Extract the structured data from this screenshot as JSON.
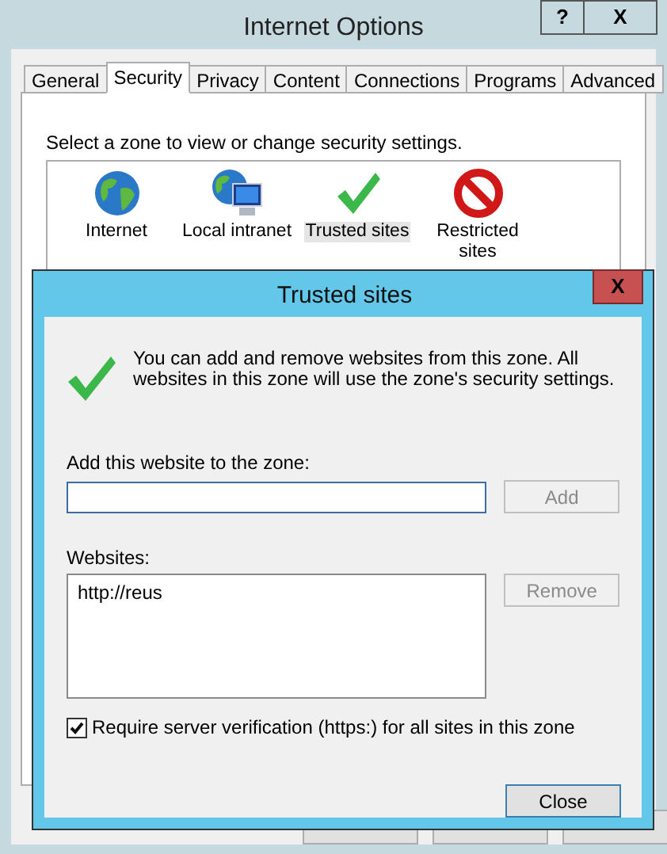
{
  "window": {
    "title": "Internet Options",
    "buttons": [
      "?",
      "X"
    ]
  },
  "tabs": [
    {
      "label": "General",
      "selected": false
    },
    {
      "label": "Security",
      "selected": true
    },
    {
      "label": "Privacy",
      "selected": false
    },
    {
      "label": "Content",
      "selected": false
    },
    {
      "label": "Connections",
      "selected": false
    },
    {
      "label": "Programs",
      "selected": false
    },
    {
      "label": "Advanced",
      "selected": false
    }
  ],
  "zone_prompt": "Select a zone to view or change security settings.",
  "zones": [
    {
      "kind": "globe",
      "label": "Internet",
      "selected": false
    },
    {
      "kind": "intranet",
      "label": "Local intranet",
      "selected": false
    },
    {
      "kind": "trusted",
      "label": "Trusted sites",
      "selected": true
    },
    {
      "kind": "restricted",
      "label": "Restricted sites",
      "selected": false
    }
  ],
  "dialog": {
    "title": "Trusted sites",
    "close": "X",
    "description": "You can add and remove websites from this zone. All websites in this zone will use the zone's security settings.",
    "add_label": "Add this website to the zone:",
    "add_button": {
      "label": "Add",
      "disabled": true
    },
    "websites_label": "Websites:",
    "websites": [
      "http://reus"
    ],
    "remove_button": {
      "label": "Remove",
      "disabled": true
    },
    "require_https": {
      "label": "Require server verification (https:) for all sites in this zone",
      "checked": true
    },
    "close_button": {
      "label": "Close",
      "disabled": false
    }
  }
}
